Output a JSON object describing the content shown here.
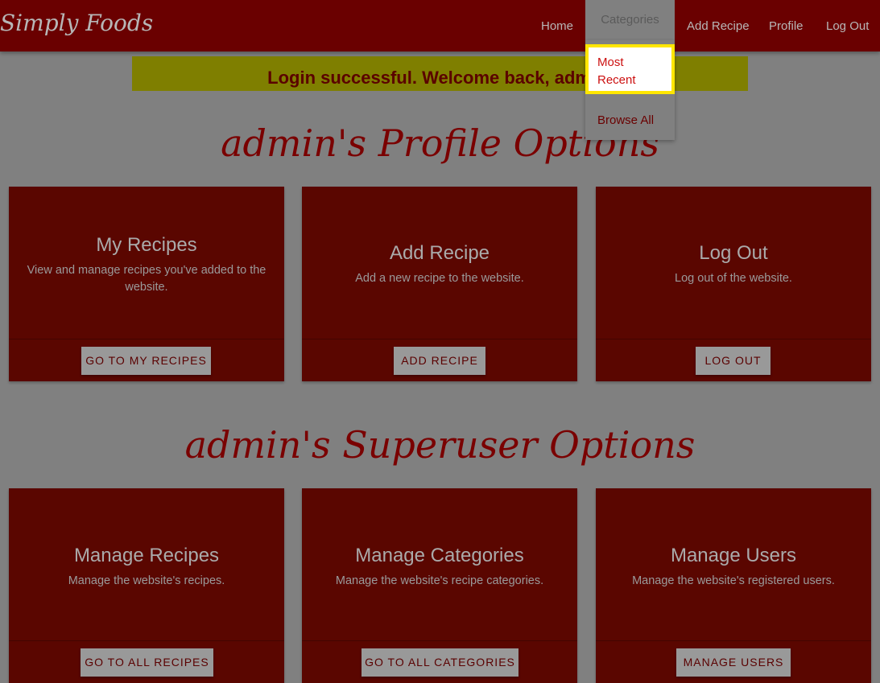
{
  "navbar": {
    "brand": "Simply Foods",
    "links": {
      "home": "Home",
      "categories": "Categories",
      "add_recipe": "Add Recipe",
      "profile": "Profile",
      "logout": "Log Out"
    },
    "dropdown": {
      "most_recent": "Most Recent",
      "browse_all": "Browse All"
    }
  },
  "alert": {
    "message": "Login successful. Welcome back, admin!"
  },
  "profile_section": {
    "title": "admin's Profile Options",
    "cards": [
      {
        "title": "My Recipes",
        "description": "View and manage recipes you've added to the website.",
        "button": "Go to My Recipes"
      },
      {
        "title": "Add Recipe",
        "description": "Add a new recipe to the website.",
        "button": "Add Recipe"
      },
      {
        "title": "Log Out",
        "description": "Log out of the website.",
        "button": "Log Out"
      }
    ]
  },
  "superuser_section": {
    "title": "admin's Superuser Options",
    "cards": [
      {
        "title": "Manage Recipes",
        "description": "Manage the website's recipes.",
        "button": "Go to All Recipes"
      },
      {
        "title": "Manage Categories",
        "description": "Manage the website's recipe categories.",
        "button": "Go to All Categories"
      },
      {
        "title": "Manage Users",
        "description": "Manage the website's registered users.",
        "button": "Manage Users"
      }
    ]
  },
  "colors": {
    "navbar": "#6a0000",
    "card": "#5a0600",
    "alert": "#7f7f00",
    "highlight_border": "#ffe600"
  }
}
